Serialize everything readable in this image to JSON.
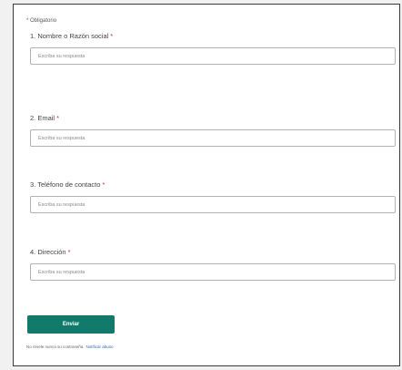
{
  "form": {
    "required_note_star": "*",
    "required_note": "Obligatorio",
    "questions": [
      {
        "title": "1. Nombre o Razón social",
        "star": "*",
        "placeholder": "Escriba su respuesta"
      },
      {
        "title": "2. Email",
        "star": "*",
        "placeholder": "Escriba su respuesta"
      },
      {
        "title": "3. Teléfono de contacto",
        "star": "*",
        "placeholder": "Escriba su respuesta"
      },
      {
        "title": "4. Dirección",
        "star": "*",
        "placeholder": "Escriba su respuesta"
      }
    ],
    "submit_label": "Enviar",
    "footer_note": "No revele nunca su contraseña.",
    "report_link": "Notificar abuso"
  },
  "colors": {
    "accent": "#127a6b",
    "required_star": "#c4314b",
    "link": "#2b6cb8"
  }
}
